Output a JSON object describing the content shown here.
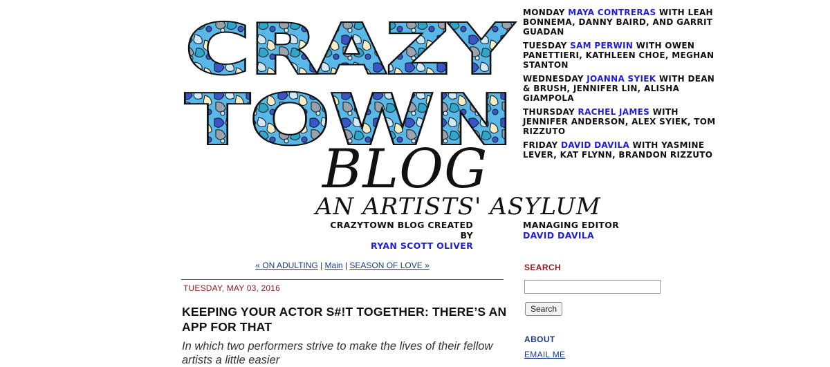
{
  "logo": {
    "line1": "CRAZY",
    "line2": "TOWN",
    "blog": "BLOG",
    "tagline": "AN ARTISTS' ASYLUM",
    "colors": {
      "mosaic_base": "#59b8e8",
      "mosaic_dark": "#3a55c8",
      "mosaic_light": "#cfe9f7",
      "mosaic_cream": "#f4eec8",
      "mosaic_gray": "#9aa3ad",
      "outline": "#111111"
    }
  },
  "credits": {
    "left_label": "CRAZYTOWN BLOG CREATED BY",
    "left_name": "RYAN SCOTT OLIVER",
    "right_label": "MANAGING EDITOR",
    "right_name": "DAVID DAVILA"
  },
  "schedule": [
    {
      "day": "MONDAY",
      "host": "MAYA CONTRERAS",
      "with": "WITH",
      "rest": "LEAH BONNEMA, DANNY BAIRD, AND GARRIT GUADAN"
    },
    {
      "day": "TUESDAY",
      "host": "SAM PERWIN",
      "with": "WITH",
      "rest": "OWEN PANETTIERI, KATHLEEN CHOE, MEGHAN STANTON"
    },
    {
      "day": "WEDNESDAY",
      "host": "JOANNA SYIEK",
      "with": "WITH",
      "rest": "DEAN & BRUSH, JENNIFER LIN, ALISHA GIAMPOLA"
    },
    {
      "day": "THURSDAY",
      "host": "RACHEL JAMES",
      "with": "WITH",
      "rest": "JENNIFER ANDERSON, ALEX SYIEK, TOM RIZZUTO"
    },
    {
      "day": "FRIDAY",
      "host": "DAVID DAVILA",
      "with": "WITH",
      "rest": "YASMINE LEVER, KAT FLYNN, BRANDON RIZZUTO"
    }
  ],
  "post_nav": {
    "prev": "« ON ADULTING",
    "sep1": " | ",
    "main": "Main",
    "sep2": " | ",
    "next": "SEASON OF LOVE »"
  },
  "post": {
    "date": "TUESDAY, MAY 03, 2016",
    "title": "KEEPING YOUR ACTOR S#!T TOGETHER: THERE’S AN APP FOR THAT",
    "subtitle": "In which two performers strive to make the lives of their fellow artists a little easier"
  },
  "sidebar": {
    "search_heading": "SEARCH",
    "search_value": "",
    "search_button": "Search",
    "about_heading": "ABOUT",
    "email_link": "EMAIL ME"
  }
}
